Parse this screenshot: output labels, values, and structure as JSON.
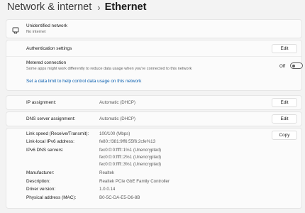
{
  "header": {
    "parent": "Network & internet",
    "separator": "›",
    "current": "Ethernet"
  },
  "network": {
    "icon": "ethernet-icon",
    "name": "Unidentified network",
    "status": "No internet"
  },
  "auth": {
    "label": "Authentication settings",
    "button": "Edit"
  },
  "metered": {
    "label": "Metered connection",
    "description": "Some apps might work differently to reduce data usage when you're connected to this network",
    "toggle_label": "Off",
    "toggle_on": false,
    "data_limit_link": "Set a data limit to help control data usage on this network"
  },
  "ip": {
    "label": "IP assignment:",
    "value": "Automatic (DHCP)",
    "button": "Edit"
  },
  "dns": {
    "label": "DNS server assignment:",
    "value": "Automatic (DHCP)",
    "button": "Edit"
  },
  "properties": {
    "copy_button": "Copy",
    "link_speed_label": "Link speed (Receive/Transmit):",
    "link_speed_value": "100/100 (Mbps)",
    "ipv6_label": "Link-local IPv6 address:",
    "ipv6_value": "fe80::f381:9ff6:55f6:2cfe%13",
    "ipv6_dns_label": "IPv6 DNS servers:",
    "ipv6_dns_values": [
      "fec0:0:0:ffff::1%1 (Unencrypted)",
      "fec0:0:0:ffff::2%1 (Unencrypted)",
      "fec0:0:0:ffff::3%1 (Unencrypted)"
    ],
    "manufacturer_label": "Manufacturer:",
    "manufacturer_value": "Realtek",
    "description_label": "Description:",
    "description_value": "Realtek PCIe GbE Family Controller",
    "driver_label": "Driver version:",
    "driver_value": "1.0.0.14",
    "mac_label": "Physical address (MAC):",
    "mac_value": "B0-5C-DA-E5-D6-8B"
  }
}
